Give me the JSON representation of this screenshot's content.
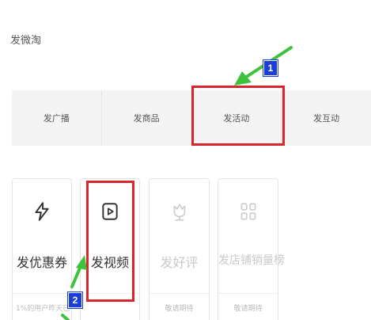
{
  "page": {
    "title": "发微淘"
  },
  "tabs": [
    {
      "label": "发广播"
    },
    {
      "label": "发商品"
    },
    {
      "label": "发活动"
    },
    {
      "label": "发互动"
    }
  ],
  "cards": [
    {
      "label": "发优惠券",
      "sub": "1%的用户昨天已使用",
      "icon": "lightning-icon",
      "enabled": true
    },
    {
      "label": "发视频",
      "sub": "",
      "icon": "video-play-icon",
      "enabled": true
    },
    {
      "label": "发好评",
      "sub": "敬请期待",
      "icon": "flower-icon",
      "enabled": false
    },
    {
      "label": "发店铺销量榜",
      "sub": "敬请期待",
      "icon": "grid-icon",
      "enabled": false
    }
  ],
  "annotations": [
    {
      "number": "1"
    },
    {
      "number": "2"
    }
  ],
  "colors": {
    "highlight": "#d9262e",
    "arrow": "#3cc23c",
    "badge": "#1b3fd6",
    "tab_bg": "#f4f4f4"
  }
}
